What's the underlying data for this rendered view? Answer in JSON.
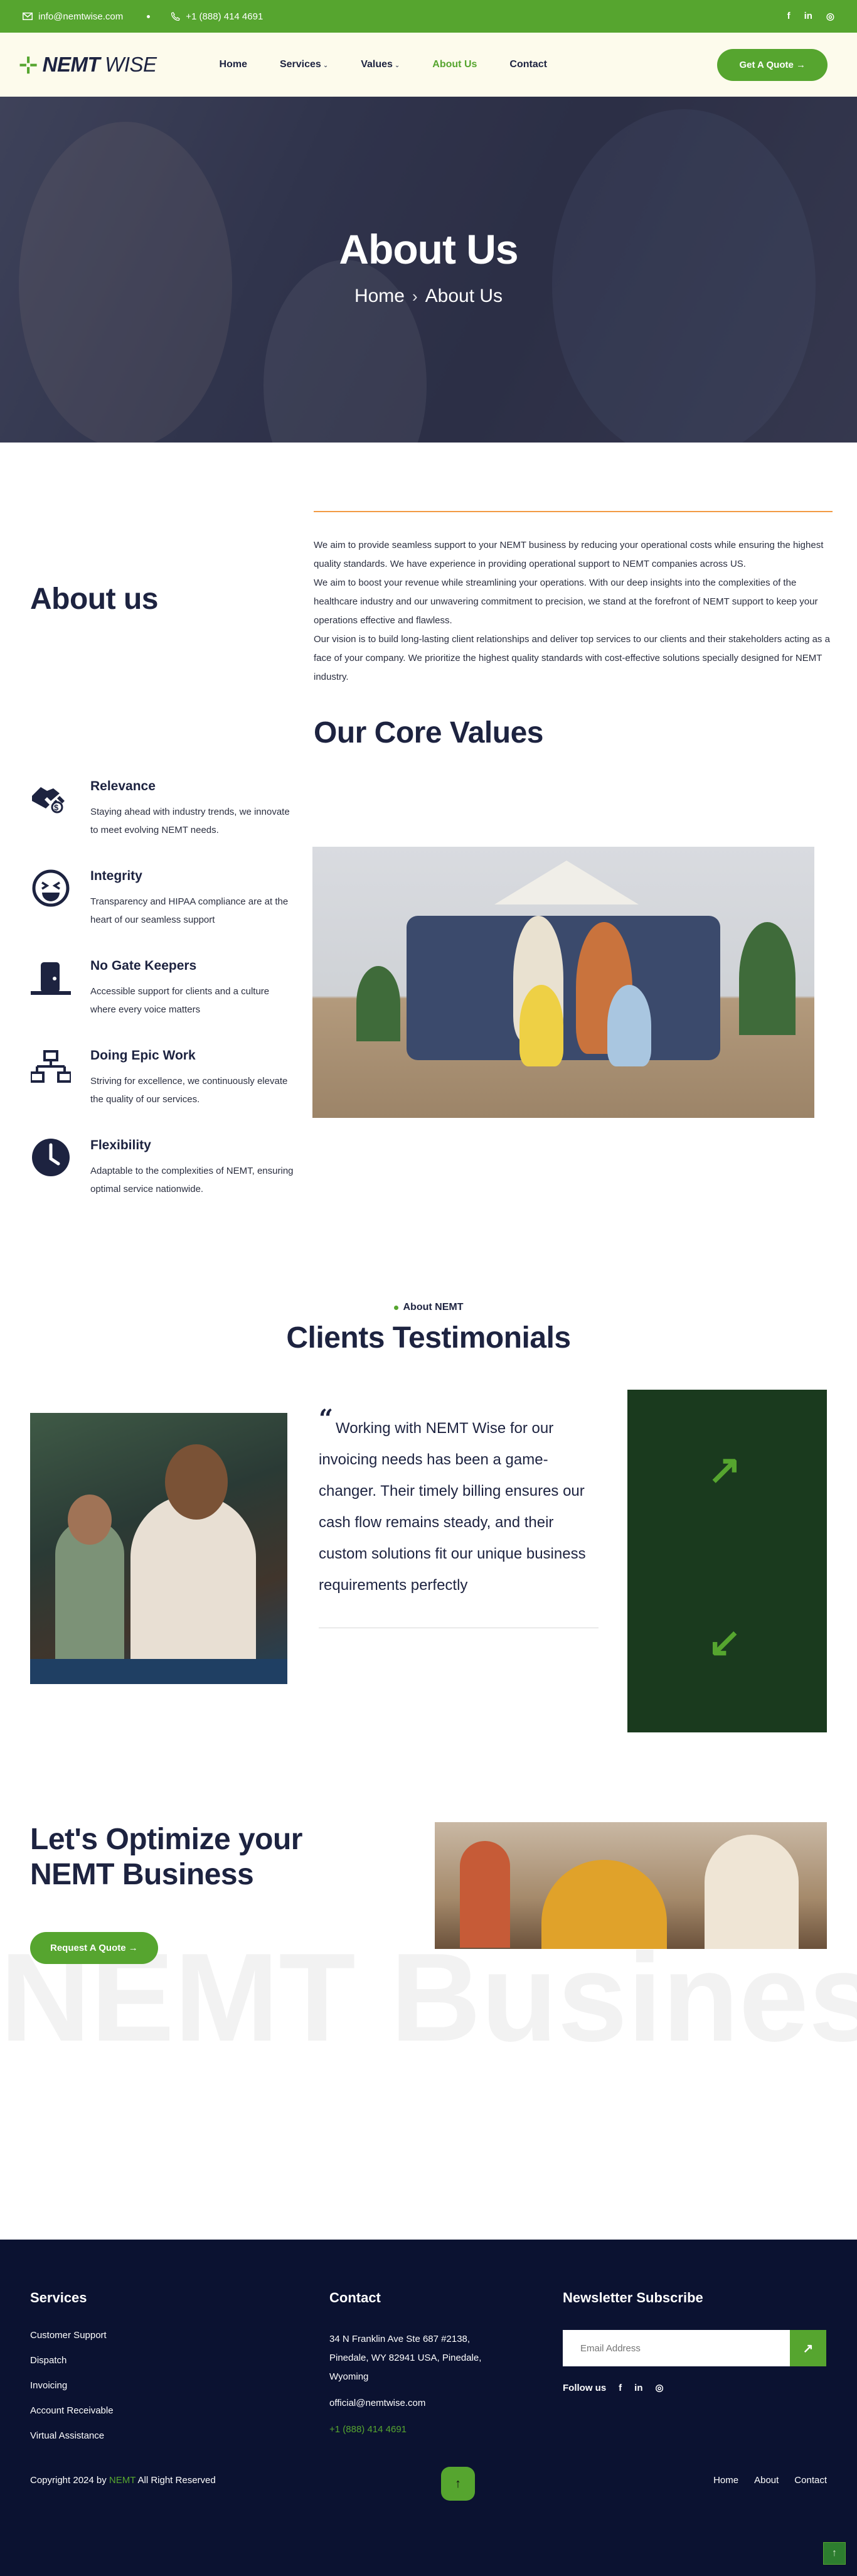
{
  "topbar": {
    "email": "info@nemtwise.com",
    "phone": "+1 (888) 414 4691",
    "social": [
      "f",
      "in",
      "◎"
    ]
  },
  "header": {
    "logo_bold": "NEMT",
    "logo_light": "WISE",
    "nav": [
      {
        "label": "Home",
        "caret": ""
      },
      {
        "label": "Services",
        "caret": "⌄"
      },
      {
        "label": "Values",
        "caret": "⌄"
      },
      {
        "label": "About Us",
        "caret": ""
      },
      {
        "label": "Contact",
        "caret": ""
      }
    ],
    "quote_btn": "Get A Quote →"
  },
  "hero": {
    "title": "About Us",
    "crumb_home": "Home",
    "crumb_sep": "›",
    "crumb_current": "About Us"
  },
  "about": {
    "title": "About us",
    "paragraphs": [
      "We aim to provide seamless support to your NEMT business by reducing your operational costs while ensuring the highest quality standards. We have experience in providing operational support to NEMT companies across US.",
      "We aim to boost your revenue while streamlining your operations. With our deep insights into the complexities of the healthcare industry and our unwavering commitment to precision, we stand at the forefront of NEMT support to keep your operations effective and flawless.",
      "Our vision is to build long-lasting client relationships and deliver top services to our clients and their stakeholders acting as a face of your company. We prioritize the highest quality standards with cost-effective solutions specially designed for NEMT industry."
    ]
  },
  "core_values": {
    "title": "Our Core Values",
    "items": [
      {
        "title": "Relevance",
        "text": "Staying ahead with industry trends, we innovate to meet evolving NEMT needs."
      },
      {
        "title": "Integrity",
        "text": "Transparency and HIPAA compliance are at the heart of our seamless support"
      },
      {
        "title": "No Gate Keepers",
        "text": "Accessible support for clients and a culture where every voice matters"
      },
      {
        "title": "Doing Epic Work",
        "text": "Striving for excellence, we continuously elevate the quality of our services."
      },
      {
        "title": "Flexibility",
        "text": "Adaptable to the complexities of NEMT, ensuring optimal service nationwide."
      }
    ]
  },
  "testimonials": {
    "eyebrow": "About NEMT",
    "title": "Clients Testimonials",
    "quote": "Working with NEMT Wise for our invoicing needs has been a game-changer. Their timely billing ensures our cash flow remains steady, and their custom solutions fit our unique business requirements perfectly",
    "quote_mark": "“",
    "next_arrow": "↗",
    "prev_arrow": "↙"
  },
  "optimize": {
    "title_line1": "Let's Optimize your",
    "title_line2": "NEMT Business",
    "button": "Request A Quote →",
    "bg_text": "NEMT Business"
  },
  "footer": {
    "services_title": "Services",
    "services": [
      "Customer Support",
      "Dispatch",
      "Invoicing",
      "Account Receivable",
      "Virtual Assistance"
    ],
    "contact_title": "Contact",
    "address": "34 N Franklin Ave Ste 687 #2138, Pinedale, WY 82941 USA, Pinedale, Wyoming",
    "email": "official@nemtwise.com",
    "phone": "+1 (888) 414 4691",
    "newsletter_title": "Newsletter Subscribe",
    "email_placeholder": "Email Address",
    "follow_label": "Follow us",
    "copyright_pre": "Copyright 2024 by ",
    "copyright_brand": "NEMT",
    "copyright_post": " All Right Reserved",
    "bottom_links": [
      "Home",
      "About",
      "Contact"
    ]
  },
  "colors": {
    "brand_green": "#56a52f",
    "navy": "#1d2340",
    "footer_bg": "#0b1231",
    "accent_orange": "#f29a43",
    "dark_green_panel": "#1a3a1e"
  }
}
